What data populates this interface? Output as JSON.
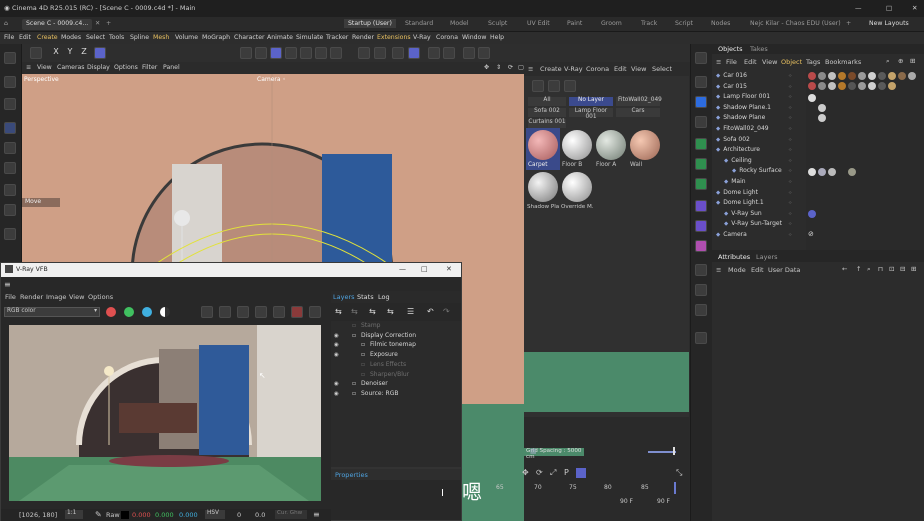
{
  "window": {
    "title": "Cinema 4D R25.015 (RC) - [Scene C - 0009.c4d *] - Main",
    "doc_tab": "Scene C - 0009.c4...",
    "controls": [
      "—",
      "□",
      "✕"
    ]
  },
  "layout_tabs": [
    "Startup (User)",
    "Standard",
    "Model",
    "Sculpt",
    "UV Edit",
    "Paint",
    "Groom",
    "Track",
    "Script",
    "Nodes",
    "Nejc Kilar - Chaos EDU (User)",
    "+",
    "New Layouts"
  ],
  "main_menu": [
    "File",
    "Edit",
    "Create",
    "Modes",
    "Select",
    "Tools",
    "Spline",
    "Mesh",
    "Volume",
    "MoGraph",
    "Character",
    "Animate",
    "Simulate",
    "Tracker",
    "Render",
    "Extensions",
    "V-Ray",
    "Corona",
    "Window",
    "Help"
  ],
  "axis_buttons": [
    "X",
    "Y",
    "Z"
  ],
  "viewport": {
    "menu": [
      "View",
      "Cameras",
      "Display",
      "Options",
      "Filter",
      "Panel"
    ],
    "label": "Perspective",
    "camera_label": "Camera ◦",
    "move_label": "Move"
  },
  "materials": {
    "menu": [
      "Create",
      "V-Ray",
      "Corona",
      "Edit",
      "View",
      "Select"
    ],
    "layer_filters": [
      "All",
      "No Layer",
      "FitoWall02_049",
      "Sofa 002",
      "Lamp Floor 001",
      "Cars",
      "Curtains 001"
    ],
    "swatches": [
      {
        "name": "Carpet",
        "color": "#d99a9a"
      },
      {
        "name": "Floor B",
        "color": "#e0e0e0"
      },
      {
        "name": "Floor A",
        "color": "#b9c0b8"
      },
      {
        "name": "Wall",
        "color": "#d9a58c"
      },
      {
        "name": "Shadow Pla",
        "color": "#cfcfcf"
      },
      {
        "name": "Override M.",
        "color": "#e6e6e6"
      }
    ],
    "grid_spacing": "Grid Spacing : 5000 cm"
  },
  "timeline": {
    "ticks": [
      "65",
      "70",
      "75",
      "80",
      "85"
    ],
    "frame_a": "90 F",
    "frame_b": "90 F"
  },
  "objects_panel": {
    "tabs": [
      "Objects",
      "Takes"
    ],
    "menu": [
      "File",
      "Edit",
      "View",
      "Object",
      "Tags",
      "Bookmarks"
    ],
    "items": [
      {
        "name": "Car 016",
        "indent": 0
      },
      {
        "name": "Car 015",
        "indent": 0
      },
      {
        "name": "Lamp Floor 001",
        "indent": 0
      },
      {
        "name": "Shadow Plane.1",
        "indent": 0
      },
      {
        "name": "Shadow Plane",
        "indent": 0
      },
      {
        "name": "FitoWall02_049",
        "indent": 0
      },
      {
        "name": "Sofa 002",
        "indent": 0
      },
      {
        "name": "Architecture",
        "indent": 0
      },
      {
        "name": "Ceiling",
        "indent": 1
      },
      {
        "name": "Rocky Surface",
        "indent": 2
      },
      {
        "name": "Main",
        "indent": 1
      },
      {
        "name": "Dome Light",
        "indent": 0
      },
      {
        "name": "Dome Light.1",
        "indent": 0
      },
      {
        "name": "V-Ray Sun",
        "indent": 1
      },
      {
        "name": "V-Ray Sun-Target",
        "indent": 1
      },
      {
        "name": "Camera",
        "indent": 0
      }
    ]
  },
  "attributes_panel": {
    "tabs": [
      "Attributes",
      "Layers"
    ],
    "menu": [
      "Mode",
      "Edit",
      "User Data"
    ]
  },
  "vfb": {
    "title": "V-Ray VFB",
    "menu": [
      "File",
      "Render",
      "Image",
      "View",
      "Options"
    ],
    "channel": "RGB color",
    "panel_tabs": [
      "Layers",
      "Stats",
      "Log"
    ],
    "layers": [
      {
        "name": "Stamp",
        "indent": 0,
        "enabled": false
      },
      {
        "name": "Display Correction",
        "indent": 0,
        "enabled": true
      },
      {
        "name": "Filmic tonemap",
        "indent": 1,
        "enabled": true
      },
      {
        "name": "Exposure",
        "indent": 1,
        "enabled": true
      },
      {
        "name": "Lens Effects",
        "indent": 1,
        "enabled": false
      },
      {
        "name": "Sharpen/Blur",
        "indent": 1,
        "enabled": false
      },
      {
        "name": "Denoiser",
        "indent": 0,
        "enabled": true
      },
      {
        "name": "Source: RGB",
        "indent": 0,
        "enabled": true
      }
    ],
    "properties_label": "Properties",
    "status": {
      "coords": "[1026, 180]",
      "zoom": "1:1",
      "mode": "Raw",
      "r": "0.000",
      "g": "0.000",
      "b": "0.000",
      "colorspace": "HSV",
      "h": "0",
      "v": "0.0",
      "extra": "Cur. Ghw"
    }
  },
  "subtitle": "嗯"
}
